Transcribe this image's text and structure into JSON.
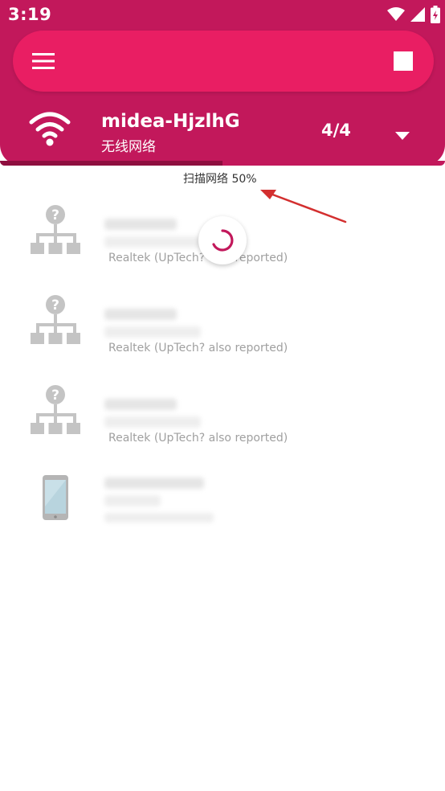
{
  "status_bar": {
    "time": "3:19",
    "icons": [
      "wifi-signal-icon",
      "cell-signal-icon",
      "battery-charging-icon"
    ]
  },
  "toolbar": {
    "menu_icon": "menu-icon",
    "stop_icon": "stop-icon"
  },
  "network": {
    "name": "midea-HjzlhG",
    "type": "无线网络",
    "count": "4/4",
    "icon": "wifi-icon",
    "dropdown_icon": "dropdown-arrow-icon"
  },
  "scan": {
    "label": "扫描网络 50%",
    "progress": 0.5
  },
  "devices": [
    {
      "icon": "unknown-network-device-icon",
      "vendor": "Realtek (UpTech? also reported)"
    },
    {
      "icon": "unknown-network-device-icon",
      "vendor": "Realtek (UpTech? also reported)"
    },
    {
      "icon": "unknown-network-device-icon",
      "vendor": "Realtek (UpTech? also reported)"
    },
    {
      "icon": "smartphone-icon",
      "vendor": ""
    }
  ],
  "colors": {
    "primary": "#c2185b",
    "accent": "#e91e63",
    "annotation_arrow": "#d32f2f"
  }
}
